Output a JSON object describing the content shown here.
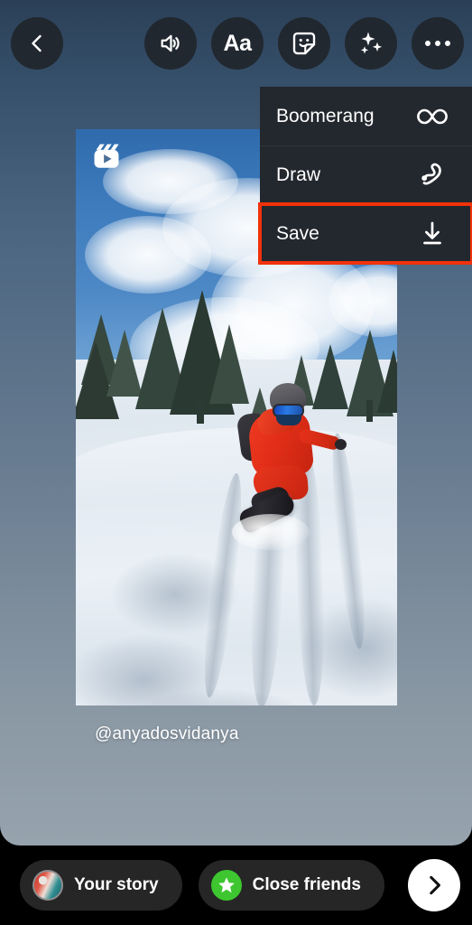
{
  "app": {
    "screen_name": "Instagram Story Editor"
  },
  "toolbar": {
    "back_icon": "chevron-left-icon",
    "items": [
      {
        "name": "audio",
        "icon": "speaker-volume-icon",
        "label": ""
      },
      {
        "name": "text",
        "icon": "text-aa-icon",
        "label": "Aa"
      },
      {
        "name": "sticker",
        "icon": "sticker-smiley-icon",
        "label": ""
      },
      {
        "name": "effects",
        "icon": "sparkles-icon",
        "label": ""
      },
      {
        "name": "more",
        "icon": "three-dots-icon",
        "label": ""
      }
    ]
  },
  "menu": {
    "items": [
      {
        "label": "Boomerang",
        "icon": "infinity-icon",
        "highlighted": false
      },
      {
        "label": "Draw",
        "icon": "squiggle-pen-icon",
        "highlighted": false
      },
      {
        "label": "Save",
        "icon": "download-arrow-icon",
        "highlighted": true
      }
    ],
    "highlight_color": "#f0320a",
    "background_color": "#23272e"
  },
  "media": {
    "badge_icon": "reels-clapperboard-icon",
    "caption": "@anyadosvidanya",
    "description": "Snowboarder in red jacket riding powder snow through snow-covered pine trees under a blue sky with clouds"
  },
  "bottom_bar": {
    "your_story_label": "Your story",
    "close_friends_label": "Close friends",
    "next_icon": "chevron-right-icon",
    "avatar_icon": "user-avatar",
    "close_friends_icon": "green-star-icon",
    "close_friends_color": "#3dc62f"
  }
}
